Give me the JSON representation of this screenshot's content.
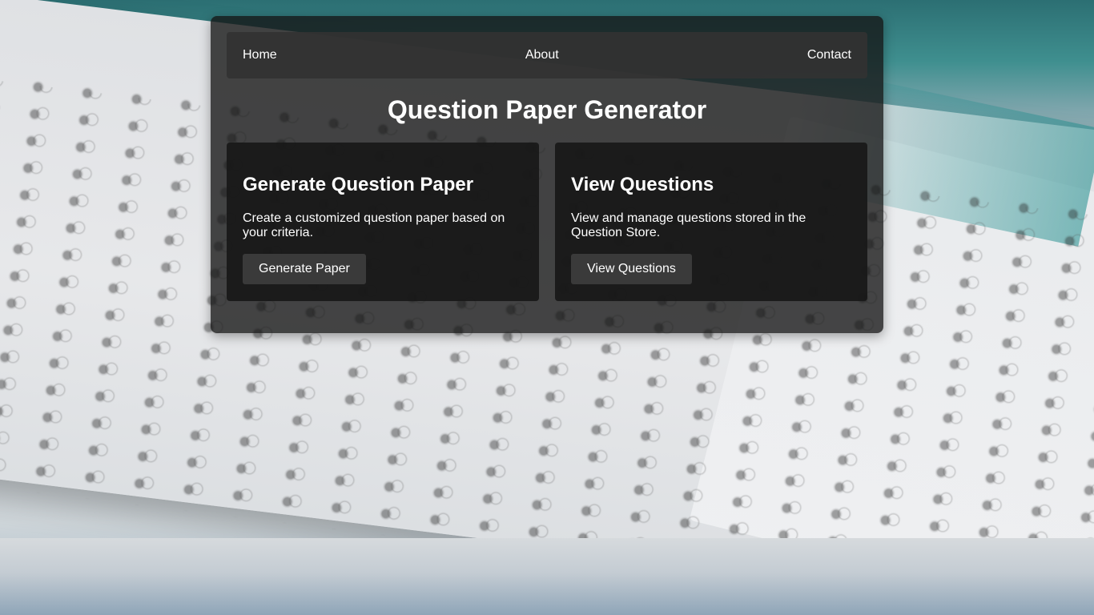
{
  "nav": {
    "items": [
      {
        "label": "Home"
      },
      {
        "label": "About"
      },
      {
        "label": "Contact"
      }
    ]
  },
  "page": {
    "title": "Question Paper Generator"
  },
  "cards": [
    {
      "title": "Generate Question Paper",
      "description": "Create a customized question paper based on your criteria.",
      "button_label": "Generate Paper"
    },
    {
      "title": "View Questions",
      "description": "View and manage questions stored in the Question Store.",
      "button_label": "View Questions"
    }
  ],
  "colors": {
    "panel_bg": "#141414",
    "navbar_bg": "#323232",
    "card_bg": "#181818",
    "button_bg": "#3a3a3a",
    "text": "#ffffff"
  }
}
